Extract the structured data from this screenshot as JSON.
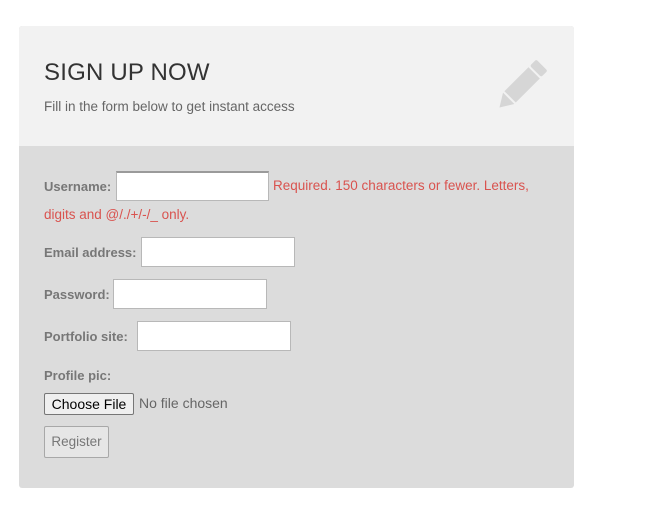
{
  "header": {
    "title": "SIGN UP NOW",
    "subtitle": "Fill in the form below to get instant access",
    "icon": "pencil-icon"
  },
  "form": {
    "username": {
      "label": "Username:",
      "value": "",
      "help_line1": "Required. 150 characters or fewer. Letters,",
      "help_line2": "digits and @/./+/-/_ only."
    },
    "email": {
      "label": "Email address:",
      "value": ""
    },
    "password": {
      "label": "Password:",
      "value": ""
    },
    "portfolio": {
      "label": "Portfolio site:",
      "value": ""
    },
    "profile_pic": {
      "label": "Profile pic:",
      "button_label": "Choose File",
      "status": "No file chosen"
    },
    "submit_label": "Register"
  },
  "colors": {
    "header_bg": "#f2f2f2",
    "form_bg": "#dcdcdc",
    "error_text": "#d9534f",
    "label_text": "#777777"
  }
}
